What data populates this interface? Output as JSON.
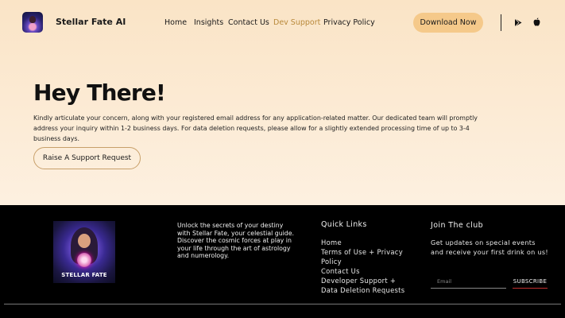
{
  "header": {
    "brand": "Stellar Fate AI",
    "logo_icon": "stellar-fate-logo",
    "nav": [
      {
        "label": "Home",
        "active": false
      },
      {
        "label": "Insights",
        "active": false
      },
      {
        "label": "Contact Us",
        "active": false
      },
      {
        "label": "Dev Support",
        "active": true
      },
      {
        "label": "Privacy Policy",
        "active": false
      }
    ],
    "download_label": "Download Now",
    "store_icons": [
      "google-play-icon",
      "apple-icon"
    ]
  },
  "hero": {
    "title": "Hey There!",
    "text": "Kindly articulate your concern, along with your registered email address for any application-related matter. Our dedicated team will promptly address your inquiry within 1-2 business days. For data deletion requests, please allow for a slightly extended processing time of up to 3-4 business days.",
    "button_label": "Raise A Support Request"
  },
  "footer": {
    "logo_caption": "STELLAR FATE",
    "tagline": "Unlock the secrets of your destiny with Stellar Fate, your celestial guide. Discover the cosmic forces at play in your life through the art of astrology and numerology.",
    "quick_links_title": "Quick Links",
    "quick_links": [
      "Home",
      "Terms of Use + Privacy Policy",
      "Contact Us",
      "Developer Support + Data Deletion Requests"
    ],
    "club_title": "Join The club",
    "club_text": "Get updates on special events and receive your first drink on us!",
    "email_placeholder": "Email",
    "subscribe_label": "SUBSCRIBE"
  },
  "colors": {
    "accent": "#f5c98a",
    "active_nav": "#b8893a",
    "hero_bg": "#fbe8cf",
    "footer_bg": "#000000"
  }
}
